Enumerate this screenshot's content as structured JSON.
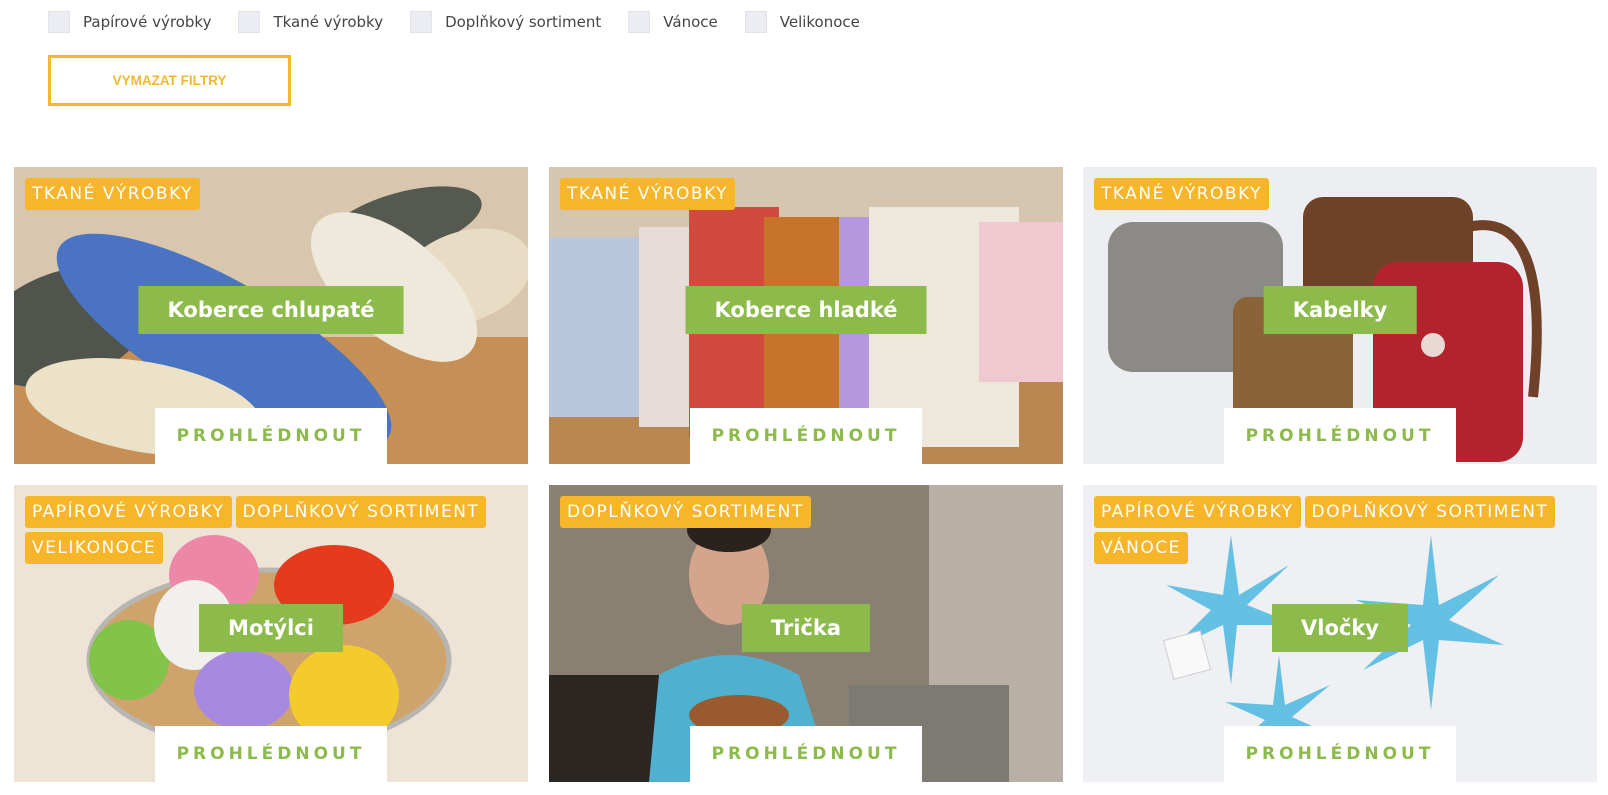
{
  "filters": [
    {
      "label": "Papírové výrobky"
    },
    {
      "label": "Tkané výrobky"
    },
    {
      "label": "Doplňkový sortiment"
    },
    {
      "label": "Vánoce"
    },
    {
      "label": "Velikonoce"
    }
  ],
  "clear_button_label": "VYMAZAT FILTRY",
  "view_label": "PROHLÉDNOUT",
  "colors": {
    "accent_yellow": "#f7b52a",
    "accent_green": "#8cbb4c"
  },
  "products": [
    {
      "title": "Koberce chlupaté",
      "tags": [
        "TKANÉ VÝROBKY"
      ]
    },
    {
      "title": "Koberce hladké",
      "tags": [
        "TKANÉ VÝROBKY"
      ]
    },
    {
      "title": "Kabelky",
      "tags": [
        "TKANÉ VÝROBKY"
      ]
    },
    {
      "title": "Motýlci",
      "tags": [
        "PAPÍROVÉ VÝROBKY",
        "DOPLŇKOVÝ SORTIMENT",
        "VELIKONOCE"
      ]
    },
    {
      "title": "Trička",
      "tags": [
        "DOPLŇKOVÝ SORTIMENT"
      ]
    },
    {
      "title": "Vločky",
      "tags": [
        "PAPÍROVÉ VÝROBKY",
        "DOPLŇKOVÝ SORTIMENT",
        "VÁNOCE"
      ]
    }
  ]
}
